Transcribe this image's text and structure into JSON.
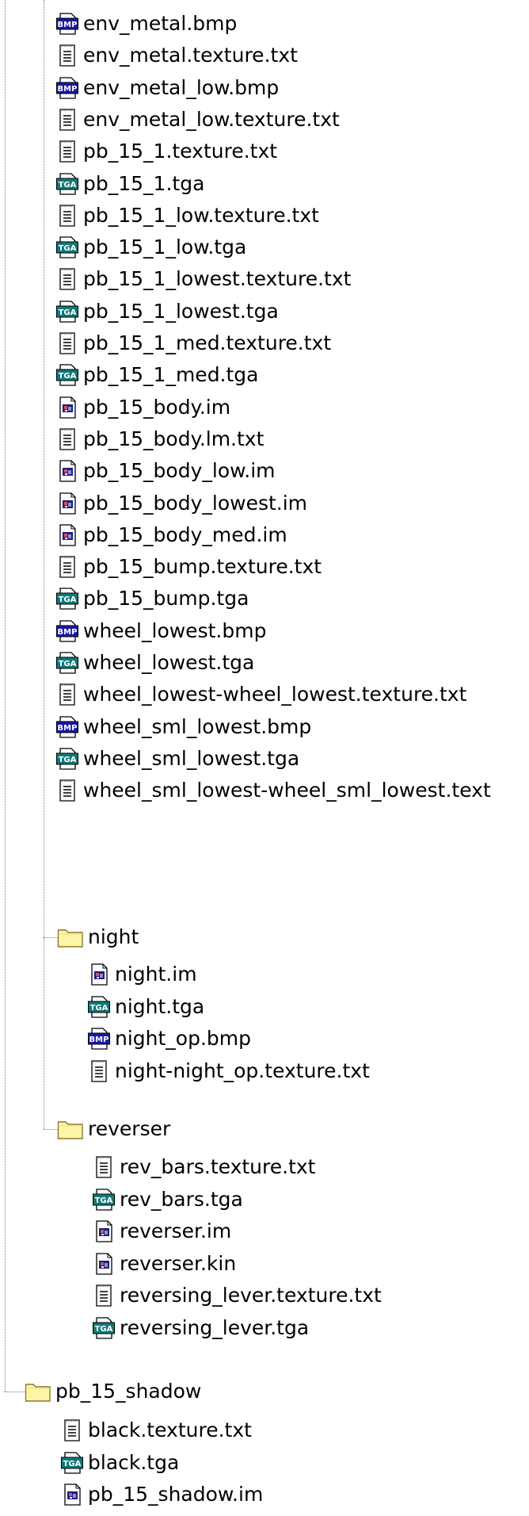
{
  "tree": {
    "group1_files": [
      {
        "name": "env_metal.bmp",
        "icon": "bmp-file-icon"
      },
      {
        "name": "env_metal.texture.txt",
        "icon": "text-file-icon"
      },
      {
        "name": "env_metal_low.bmp",
        "icon": "bmp-file-icon"
      },
      {
        "name": "env_metal_low.texture.txt",
        "icon": "text-file-icon"
      },
      {
        "name": "pb_15_1.texture.txt",
        "icon": "text-file-icon"
      },
      {
        "name": "pb_15_1.tga",
        "icon": "tga-file-icon"
      },
      {
        "name": "pb_15_1_low.texture.txt",
        "icon": "text-file-icon"
      },
      {
        "name": "pb_15_1_low.tga",
        "icon": "tga-file-icon"
      },
      {
        "name": "pb_15_1_lowest.texture.txt",
        "icon": "text-file-icon"
      },
      {
        "name": "pb_15_1_lowest.tga",
        "icon": "tga-file-icon"
      },
      {
        "name": "pb_15_1_med.texture.txt",
        "icon": "text-file-icon"
      },
      {
        "name": "pb_15_1_med.tga",
        "icon": "tga-file-icon"
      },
      {
        "name": "pb_15_body.im",
        "icon": "im-file-icon"
      },
      {
        "name": "pb_15_body.lm.txt",
        "icon": "text-file-icon"
      },
      {
        "name": "pb_15_body_low.im",
        "icon": "im-file-icon"
      },
      {
        "name": "pb_15_body_lowest.im",
        "icon": "im-file-icon"
      },
      {
        "name": "pb_15_body_med.im",
        "icon": "im-file-icon"
      },
      {
        "name": "pb_15_bump.texture.txt",
        "icon": "text-file-icon"
      },
      {
        "name": "pb_15_bump.tga",
        "icon": "tga-file-icon"
      },
      {
        "name": "wheel_lowest.bmp",
        "icon": "bmp-file-icon"
      },
      {
        "name": "wheel_lowest.tga",
        "icon": "tga-file-icon"
      },
      {
        "name": "wheel_lowest-wheel_lowest.texture.txt",
        "icon": "text-file-icon"
      },
      {
        "name": "wheel_sml_lowest.bmp",
        "icon": "bmp-file-icon"
      },
      {
        "name": "wheel_sml_lowest.tga",
        "icon": "tga-file-icon"
      },
      {
        "name": "wheel_sml_lowest-wheel_sml_lowest.text",
        "icon": "text-file-icon"
      }
    ],
    "night_folder": {
      "name": "night",
      "files": [
        {
          "name": "night.im",
          "icon": "im-file-icon"
        },
        {
          "name": "night.tga",
          "icon": "tga-file-icon"
        },
        {
          "name": "night_op.bmp",
          "icon": "bmp-file-icon"
        },
        {
          "name": "night-night_op.texture.txt",
          "icon": "text-file-icon"
        }
      ]
    },
    "reverser_folder": {
      "name": "reverser",
      "files": [
        {
          "name": "rev_bars.texture.txt",
          "icon": "text-file-icon"
        },
        {
          "name": "rev_bars.tga",
          "icon": "tga-file-icon"
        },
        {
          "name": "reverser.im",
          "icon": "im-file-icon"
        },
        {
          "name": "reverser.kin",
          "icon": "im-file-icon"
        },
        {
          "name": "reversing_lever.texture.txt",
          "icon": "text-file-icon"
        },
        {
          "name": "reversing_lever.tga",
          "icon": "tga-file-icon"
        }
      ]
    },
    "shadow_folder": {
      "name": "pb_15_shadow",
      "files": [
        {
          "name": "black.texture.txt",
          "icon": "text-file-icon"
        },
        {
          "name": "black.tga",
          "icon": "tga-file-icon"
        },
        {
          "name": "pb_15_shadow.im",
          "icon": "im-file-icon"
        }
      ]
    }
  },
  "icon_text": {
    "bmp": "BMP",
    "tga": "TGA"
  },
  "colors": {
    "bmp_badge": "#1818a8",
    "tga_badge": "#107878",
    "folder_fill": "#fdf6a8",
    "folder_stroke": "#8a7a28",
    "connector_line": "#808080"
  }
}
